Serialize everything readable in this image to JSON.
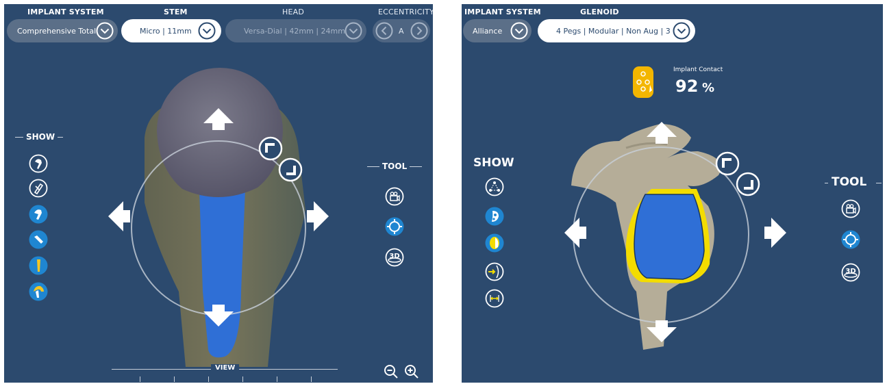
{
  "left_panel": {
    "headers": {
      "implant_system": "IMPLANT SYSTEM",
      "stem": "STEM",
      "head": "HEAD",
      "eccentricity": "ECCENTRICITY"
    },
    "implant_system_value": "Comprehensive Total",
    "stem_value": "Micro | 11mm",
    "head_value": "Versa-Dial | 42mm | 24mm",
    "eccentricity_value": "A",
    "show_label": "SHOW",
    "tool_label": "TOOL",
    "view_label": "VIEW"
  },
  "right_panel": {
    "headers": {
      "implant_system": "IMPLANT SYSTEM",
      "glenoid": "GLENOID"
    },
    "implant_system_value": "Alliance",
    "glenoid_value": "4 Pegs | Modular | Non Aug | 3",
    "contact_label": "Implant Contact",
    "contact_value": "92",
    "contact_unit": "%",
    "show_label": "SHOW",
    "tool_label": "TOOL"
  },
  "colors": {
    "background": "#2c4a6e",
    "implant_blue": "#2f6fd6",
    "contact_yellow": "#f3dc00",
    "bone": "#b5ad98"
  }
}
